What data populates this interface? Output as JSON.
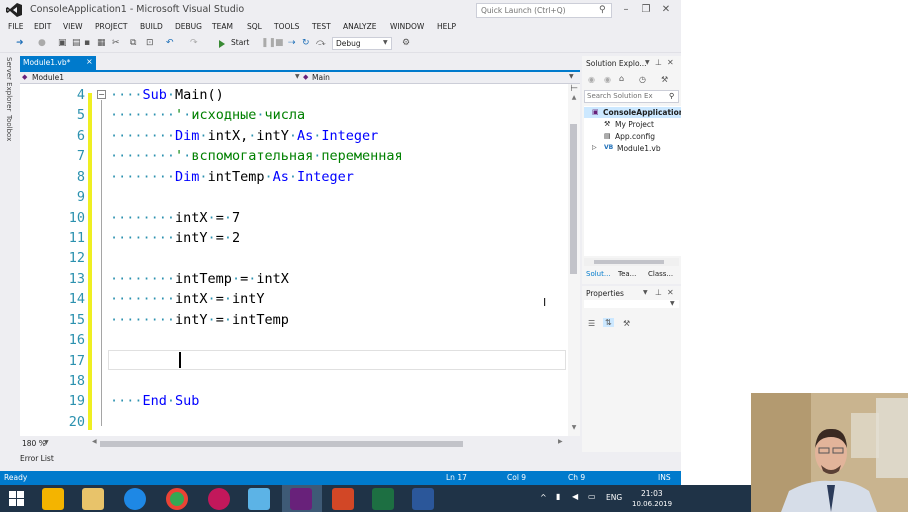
{
  "window": {
    "title": "ConsoleApplication1 - Microsoft Visual Studio",
    "quick_launch_placeholder": "Quick Launch (Ctrl+Q)"
  },
  "menu": [
    "FILE",
    "EDIT",
    "VIEW",
    "PROJECT",
    "BUILD",
    "DEBUG",
    "TEAM",
    "SQL",
    "TOOLS",
    "TEST",
    "ANALYZE",
    "WINDOW",
    "HELP"
  ],
  "toolbar": {
    "start_label": "Start",
    "config": "Debug"
  },
  "left_strip": {
    "server_explorer": "Server Explorer",
    "toolbox": "Toolbox"
  },
  "doc_tab": {
    "label": "Module1.vb*",
    "close": "×"
  },
  "nav": {
    "left": "Module1",
    "right": "Main"
  },
  "editor": {
    "line_numbers": [
      "4",
      "5",
      "6",
      "7",
      "8",
      "9",
      "10",
      "11",
      "12",
      "13",
      "14",
      "15",
      "16",
      "17",
      "18",
      "19",
      "20"
    ],
    "zoom": "180 %"
  },
  "solution_explorer": {
    "title": "Solution Explo...",
    "search_placeholder": "Search Solution Ex",
    "items": [
      "ConsoleApplication",
      "My Project",
      "App.config",
      "Module1.vb"
    ],
    "tabs": [
      "Solut...",
      "Tea...",
      "Class..."
    ]
  },
  "properties": {
    "title": "Properties"
  },
  "bottom": {
    "error_list": "Error List"
  },
  "status": {
    "ready": "Ready",
    "ln": "Ln 17",
    "col": "Col 9",
    "ch": "Ch 9",
    "ins": "INS"
  },
  "taskbar": {
    "lang": "ENG",
    "time": "21:03",
    "date": "10.06.2019"
  }
}
